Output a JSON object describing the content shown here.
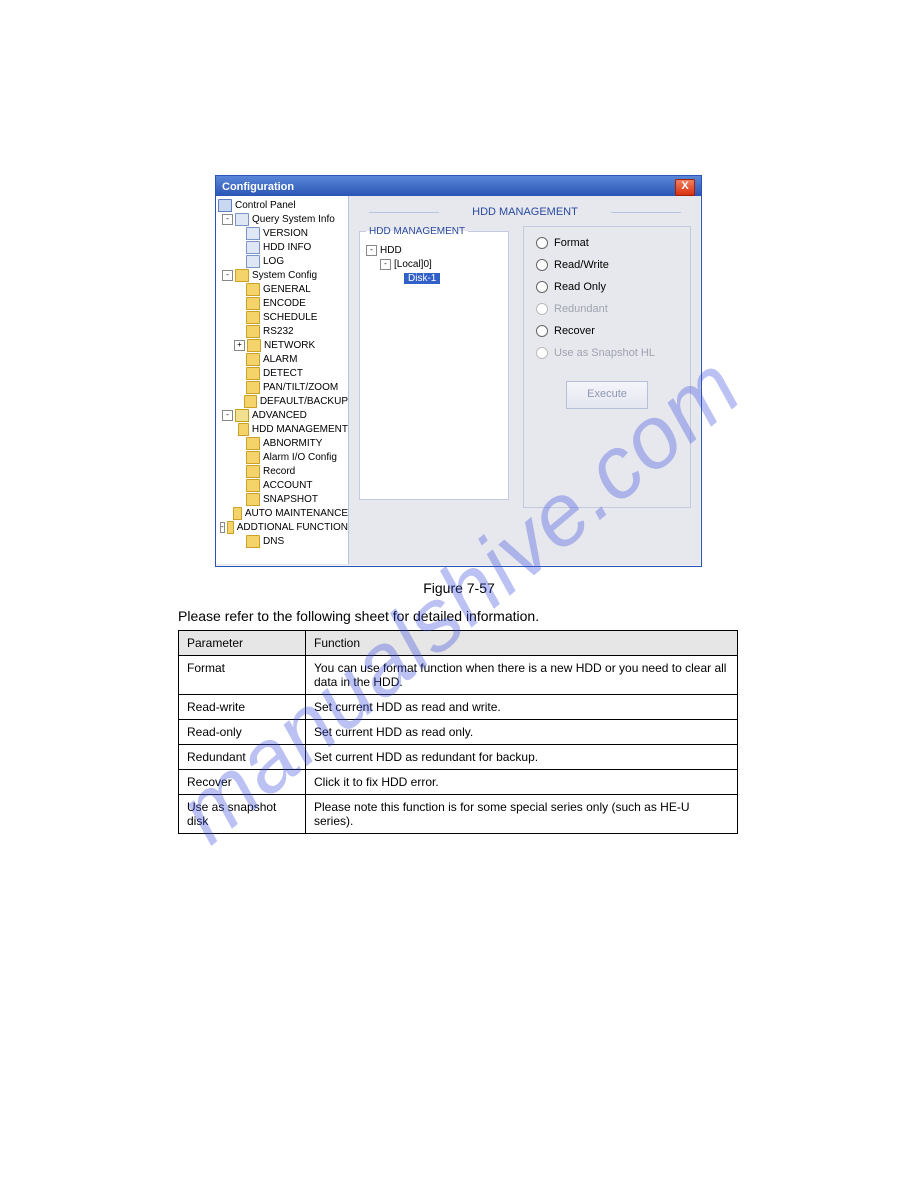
{
  "window": {
    "title": "Configuration",
    "close_glyph": "X"
  },
  "tree": {
    "root": "Control Panel",
    "groups": [
      {
        "label": "Query System Info",
        "expander": "-",
        "iconClass": "doc",
        "items": [
          {
            "label": "VERSION",
            "iconClass": "doc"
          },
          {
            "label": "HDD INFO",
            "iconClass": "doc"
          },
          {
            "label": "LOG",
            "iconClass": "doc"
          }
        ]
      },
      {
        "label": "System Config",
        "expander": "-",
        "iconClass": "",
        "items": [
          {
            "label": "GENERAL"
          },
          {
            "label": "ENCODE"
          },
          {
            "label": "SCHEDULE"
          },
          {
            "label": "RS232"
          },
          {
            "label": "NETWORK",
            "expander": "+"
          },
          {
            "label": "ALARM"
          },
          {
            "label": "DETECT"
          },
          {
            "label": "PAN/TILT/ZOOM"
          },
          {
            "label": "DEFAULT/BACKUP"
          }
        ]
      },
      {
        "label": "ADVANCED",
        "expander": "-",
        "iconClass": "adv",
        "items": [
          {
            "label": "HDD MANAGEMENT"
          },
          {
            "label": "ABNORMITY"
          },
          {
            "label": "Alarm I/O Config"
          },
          {
            "label": "Record"
          },
          {
            "label": "ACCOUNT"
          },
          {
            "label": "SNAPSHOT"
          },
          {
            "label": "AUTO MAINTENANCE"
          }
        ]
      },
      {
        "label": "ADDTIONAL FUNCTION",
        "expander": "-",
        "iconClass": "",
        "items": [
          {
            "label": "DNS"
          }
        ]
      }
    ]
  },
  "main": {
    "section_title": "HDD MANAGEMENT",
    "hdd_box_legend": "HDD MANAGEMENT",
    "hdd_tree": {
      "root": "HDD",
      "local": "[Local]0]",
      "disk": "Disk-1"
    },
    "options": [
      {
        "label": "Format",
        "disabled": false
      },
      {
        "label": "Read/Write",
        "disabled": false
      },
      {
        "label": "Read Only",
        "disabled": false
      },
      {
        "label": "Redundant",
        "disabled": true
      },
      {
        "label": "Recover",
        "disabled": false
      },
      {
        "label": "Use as Snapshot HL",
        "disabled": true
      }
    ],
    "execute_label": "Execute"
  },
  "caption": "Figure 7-57",
  "table_intro": "Please refer to the following sheet for detailed information.",
  "table": {
    "headers": [
      "Parameter",
      "Function"
    ],
    "rows": [
      [
        "Format",
        "You can use format function when there is a new HDD or you need to clear all data in the HDD."
      ],
      [
        "Read-write",
        "Set current HDD as read and write."
      ],
      [
        "Read-only",
        "Set current HDD as read only."
      ],
      [
        "Redundant",
        "Set current HDD as redundant for backup."
      ],
      [
        "Recover",
        "Click it to fix HDD error."
      ],
      [
        "Use as snapshot disk",
        "Please note this function is for some special series only (such as HE-U series)."
      ]
    ]
  },
  "watermark_text": "manualshive.com"
}
